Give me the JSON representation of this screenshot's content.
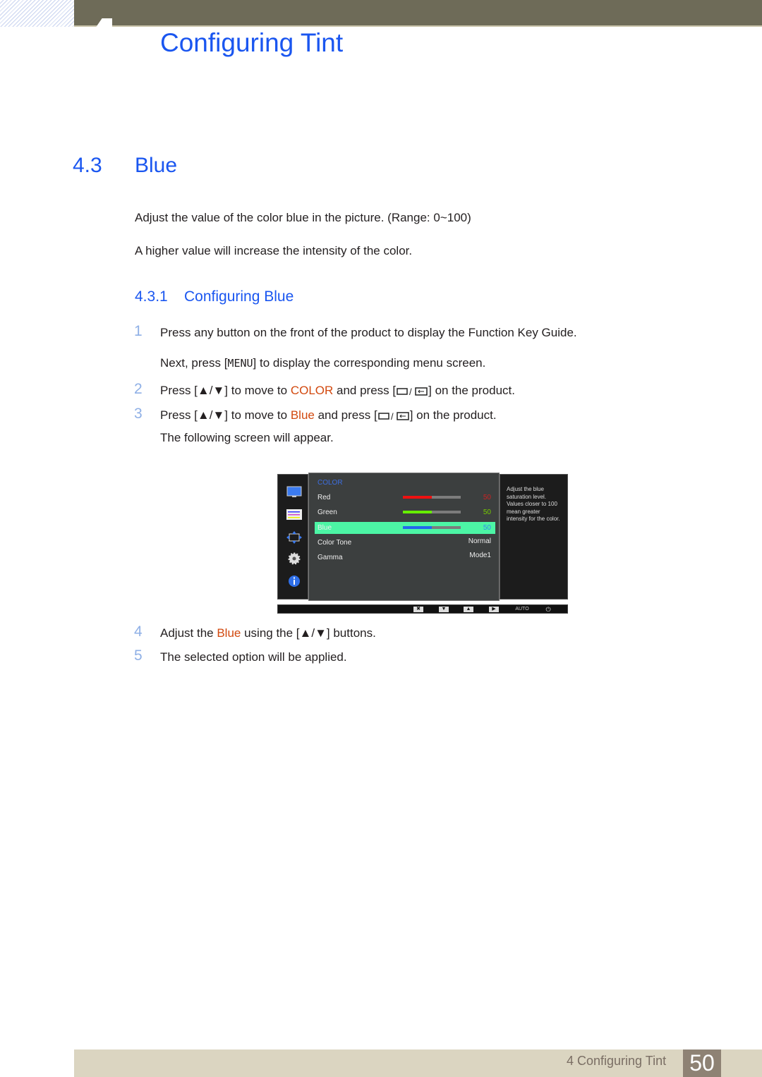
{
  "header": {
    "chapter_title": "Configuring Tint"
  },
  "section": {
    "number": "4.3",
    "title": "Blue",
    "paragraphs": [
      "Adjust the value of the color blue in the picture. (Range: 0~100)",
      "A higher value will increase the intensity of the color."
    ]
  },
  "subsection": {
    "number": "4.3.1",
    "title": "Configuring Blue"
  },
  "steps": [
    {
      "num": "1",
      "text": "Press any button on the front of the product to display the Function Key Guide.",
      "extra_pre": "Next, press [",
      "extra_key": "MENU",
      "extra_post": "] to display the corresponding menu screen."
    },
    {
      "num": "2",
      "pre": "Press [",
      "mid": "] to move to ",
      "highlight": "COLOR",
      "mid2": " and press [",
      "post": "] on the product."
    },
    {
      "num": "3",
      "pre": "Press [",
      "mid": "] to move to ",
      "highlight": "Blue",
      "mid2": " and press [",
      "post": "] on the product.",
      "extra": "The following screen will appear."
    },
    {
      "num": "4",
      "pre": "Adjust the ",
      "highlight": "Blue",
      "mid": " using the [",
      "post": "] buttons."
    },
    {
      "num": "5",
      "text": "The selected option will be applied."
    }
  ],
  "osd": {
    "menu_title": "COLOR",
    "items": [
      {
        "label": "Red",
        "value": "50",
        "level": 50,
        "color": "#ee1111",
        "value_color": "#cc2222"
      },
      {
        "label": "Green",
        "value": "50",
        "level": 50,
        "color": "#66ee00",
        "value_color": "#77cc00"
      },
      {
        "label": "Blue",
        "value": "50",
        "level": 50,
        "color": "#2266ee",
        "value_color": "#3388ee",
        "selected": true
      },
      {
        "label": "Color Tone",
        "value": "Normal"
      },
      {
        "label": "Gamma",
        "value": "Mode1"
      }
    ],
    "help": "Adjust the blue saturation level. Values closer to 100 mean greater intensity for the color.",
    "bottom_buttons": [
      "✖",
      "▼",
      "▲",
      "▶",
      "AUTO",
      "⏻"
    ]
  },
  "footer": {
    "text": "4 Configuring Tint",
    "page": "50"
  }
}
